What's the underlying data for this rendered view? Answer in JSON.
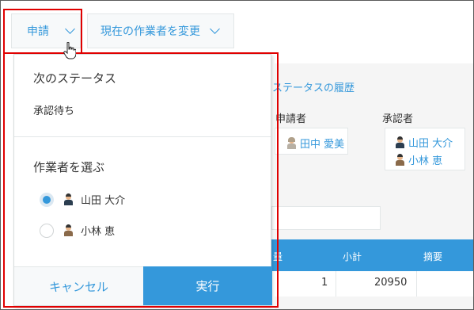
{
  "toolbar": {
    "apply_label": "申請",
    "change_worker_label": "現在の作業者を変更"
  },
  "record": {
    "history_link": "ステータスの履歴",
    "applicant_header": "申請者",
    "approver_header": "承認者",
    "applicant": "田中 愛美",
    "approvers": [
      "山田 大介",
      "小林 恵"
    ],
    "table": {
      "headers": [
        "量",
        "小計",
        "摘要"
      ],
      "rows": [
        [
          "1",
          "20950",
          ""
        ]
      ]
    }
  },
  "dropdown": {
    "next_status_title": "次のステータス",
    "next_status_value": "承認待ち",
    "select_worker_title": "作業者を選ぶ",
    "workers": [
      {
        "name": "山田 大介",
        "selected": true
      },
      {
        "name": "小林 恵",
        "selected": false
      }
    ],
    "cancel_label": "キャンセル",
    "execute_label": "実行"
  },
  "colors": {
    "accent": "#3498db",
    "highlight": "#e00000"
  }
}
